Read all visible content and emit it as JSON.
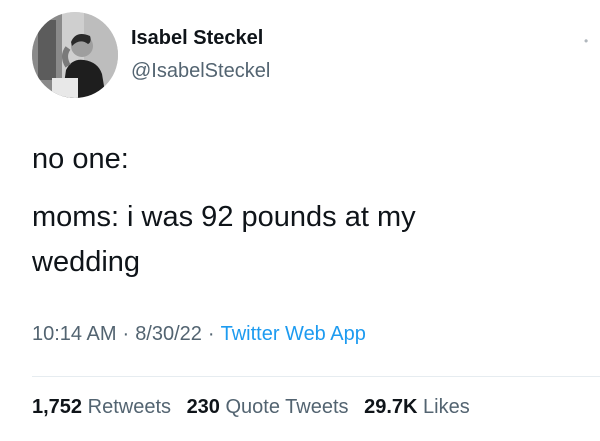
{
  "author": {
    "display_name": "Isabel Steckel",
    "handle": "@IsabelSteckel",
    "avatar_icon": "profile-photo"
  },
  "tweet": {
    "lines": [
      "no one:",
      "moms: i was 92 pounds at my",
      "wedding"
    ]
  },
  "meta": {
    "time": "10:14 AM",
    "date": "8/30/22",
    "source": "Twitter Web App",
    "separator": "·"
  },
  "stats": {
    "retweets_count": "1,752",
    "retweets_label": "Retweets",
    "quotes_count": "230",
    "quotes_label": "Quote Tweets",
    "likes_count": "29.7K",
    "likes_label": "Likes"
  },
  "colors": {
    "text_primary": "#0f1419",
    "text_secondary": "#536471",
    "link": "#1d9bf0"
  }
}
